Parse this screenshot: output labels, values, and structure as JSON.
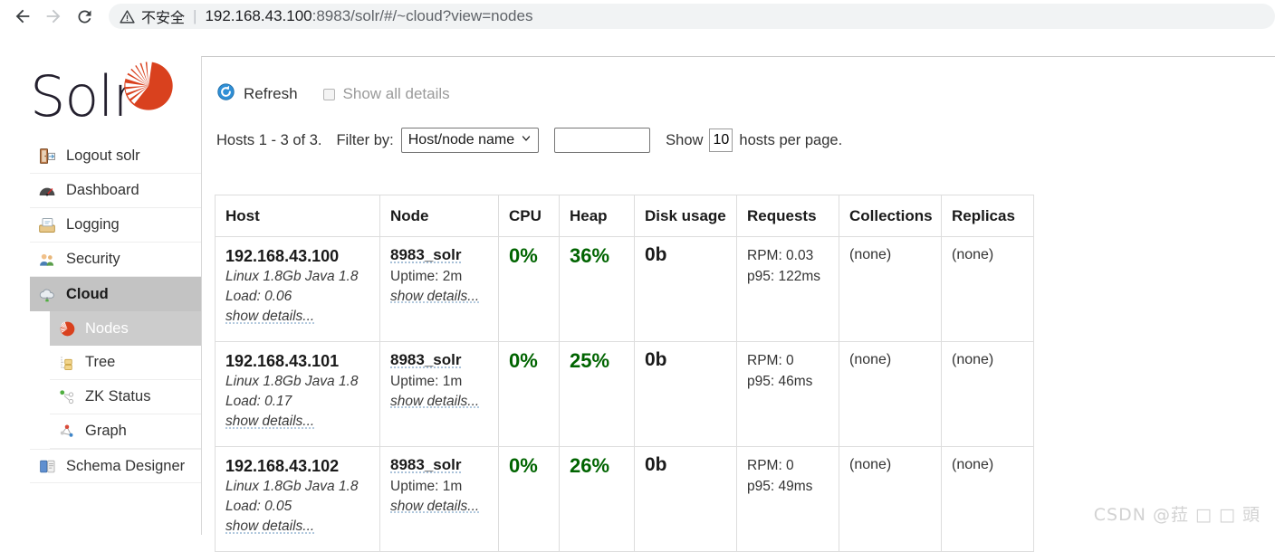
{
  "browser": {
    "back_icon": "arrow-left-icon",
    "forward_icon": "arrow-right-icon",
    "reload_icon": "reload-icon",
    "warning_icon": "warning-triangle-icon",
    "insecure_label": "不安全",
    "separator": "|",
    "url_host": "192.168.43.100",
    "url_path": ":8983/solr/#/~cloud?view=nodes"
  },
  "brand": {
    "name": "Solr",
    "logo_icon": "solr-sunburst-icon",
    "accent_color": "#d9411e"
  },
  "sidebar": {
    "items": [
      {
        "label": "Logout solr",
        "icon": "logout-door-icon",
        "active": false
      },
      {
        "label": "Dashboard",
        "icon": "gauge-icon",
        "active": false
      },
      {
        "label": "Logging",
        "icon": "logging-tray-icon",
        "active": false
      },
      {
        "label": "Security",
        "icon": "security-users-icon",
        "active": false
      },
      {
        "label": "Cloud",
        "icon": "cloud-icon",
        "active": true
      }
    ],
    "subitems": [
      {
        "label": "Nodes",
        "icon": "solr-sunburst-icon",
        "active": true
      },
      {
        "label": "Tree",
        "icon": "tree-folder-icon",
        "active": false
      },
      {
        "label": "ZK Status",
        "icon": "zk-node-icon",
        "active": false
      },
      {
        "label": "Graph",
        "icon": "graph-icon",
        "active": false
      }
    ],
    "tail_items": [
      {
        "label": "Schema Designer",
        "icon": "book-icon",
        "active": false
      }
    ]
  },
  "toolbar": {
    "refresh_label": "Refresh",
    "refresh_icon": "refresh-circular-icon",
    "show_all_details_label": "Show all details",
    "show_all_details_checked": false
  },
  "filterbar": {
    "hosts_count_text": "Hosts 1 - 3 of 3.",
    "filter_by_label": "Filter by:",
    "filter_select_value": "Host/node name",
    "filter_select_options": [
      "Host/node name"
    ],
    "filter_input_value": "",
    "filter_input_placeholder": "",
    "show_label": "Show",
    "rows_per_page": "10",
    "per_page_label": "hosts per page.",
    "chevron_icon": "chevron-down-icon"
  },
  "table": {
    "headers": [
      "Host",
      "Node",
      "CPU",
      "Heap",
      "Disk usage",
      "Requests",
      "Collections",
      "Replicas"
    ],
    "rows": [
      {
        "host_ip": "192.168.43.100",
        "host_info": "Linux 1.8Gb Java 1.8",
        "host_load": "Load: 0.06",
        "host_show_details": "show details...",
        "node_name": "8983_solr",
        "node_uptime": "Uptime: 2m",
        "node_show_details": "show details...",
        "cpu": "0%",
        "heap": "36%",
        "disk": "0b",
        "req_rpm": "RPM: 0.03",
        "req_p95": "p95: 122ms",
        "collections": "(none)",
        "replicas": "(none)"
      },
      {
        "host_ip": "192.168.43.101",
        "host_info": "Linux 1.8Gb Java 1.8",
        "host_load": "Load: 0.17",
        "host_show_details": "show details...",
        "node_name": "8983_solr",
        "node_uptime": "Uptime: 1m",
        "node_show_details": "show details...",
        "cpu": "0%",
        "heap": "25%",
        "disk": "0b",
        "req_rpm": "RPM: 0",
        "req_p95": "p95: 46ms",
        "collections": "(none)",
        "replicas": "(none)"
      },
      {
        "host_ip": "192.168.43.102",
        "host_info": "Linux 1.8Gb Java 1.8",
        "host_load": "Load: 0.05",
        "host_show_details": "show details...",
        "node_name": "8983_solr",
        "node_uptime": "Uptime: 1m",
        "node_show_details": "show details...",
        "cpu": "0%",
        "heap": "26%",
        "disk": "0b",
        "req_rpm": "RPM: 0",
        "req_p95": "p95: 49ms",
        "collections": "(none)",
        "replicas": "(none)"
      }
    ]
  },
  "watermark": {
    "text": "CSDN @菈 □ □ 頭"
  },
  "colors": {
    "metric_green": "#006400",
    "active_menu_bg": "#c3c3c3",
    "active_submenu_bg": "#cccccc"
  }
}
